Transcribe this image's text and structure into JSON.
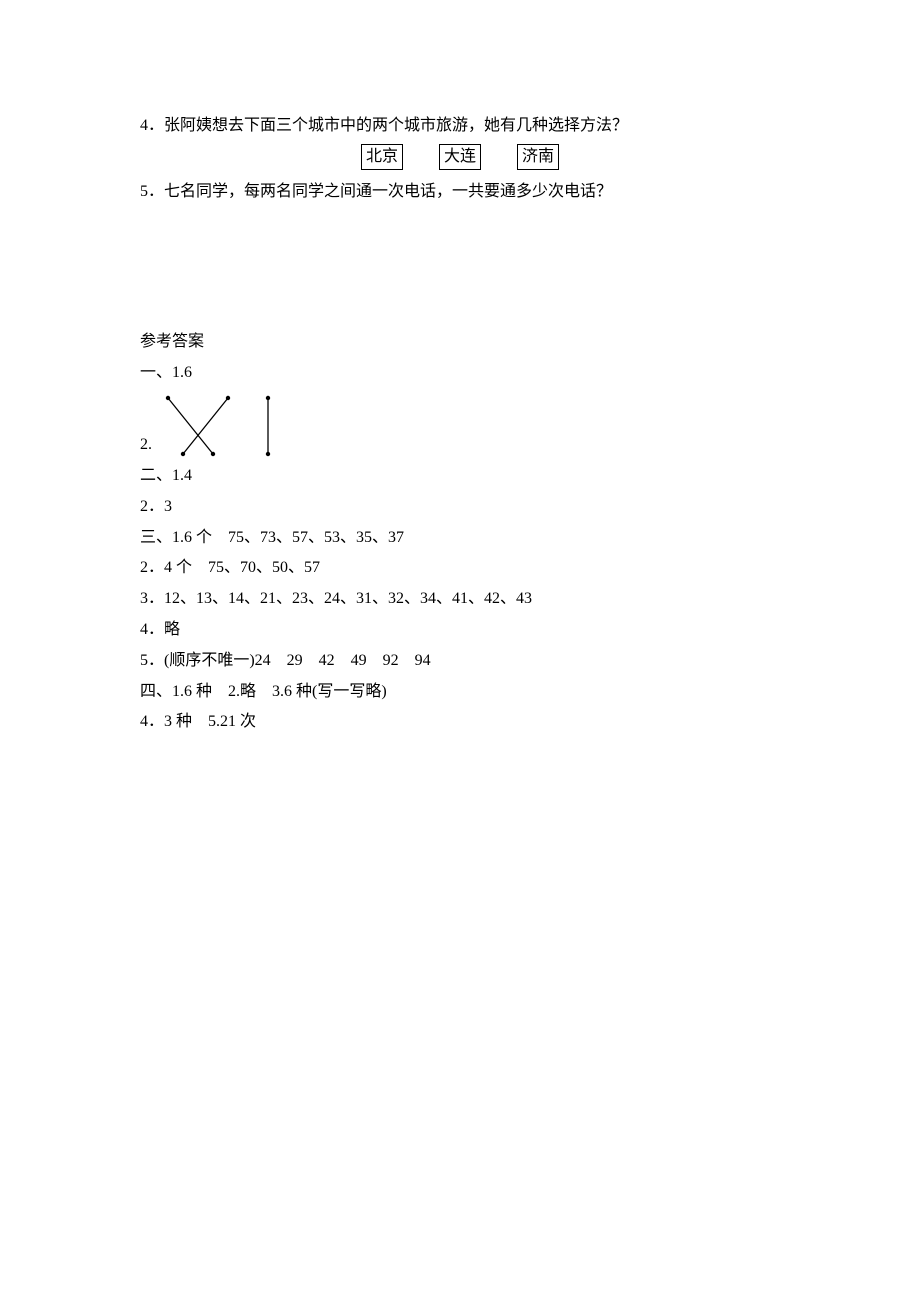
{
  "q4": {
    "num": "4．",
    "text": "张阿姨想去下面三个城市中的两个城市旅游，她有几种选择方法？",
    "cities": [
      "北京",
      "大连",
      "济南"
    ]
  },
  "q5": {
    "num": "5．",
    "text": "七名同学，每两名同学之间通一次电话，一共要通多少次电话？"
  },
  "ans": {
    "heading": "参考答案",
    "one_1": "一、1.6",
    "one_2_prefix": "2.",
    "two_1": "二、1.4",
    "two_2": "2．3",
    "three_1": "三、1.6 个　75、73、57、53、35、37",
    "three_2": "2．4 个　75、70、50、57",
    "three_3": "3．12、13、14、21、23、24、31、32、34、41、42、43",
    "three_4": "4．略",
    "three_5": "5．(顺序不唯一)24　29　42　49　92　94",
    "four_1": "四、1.6 种　2.略　3.6 种(写一写略)",
    "four_2": "4．3 种　5.21 次"
  }
}
